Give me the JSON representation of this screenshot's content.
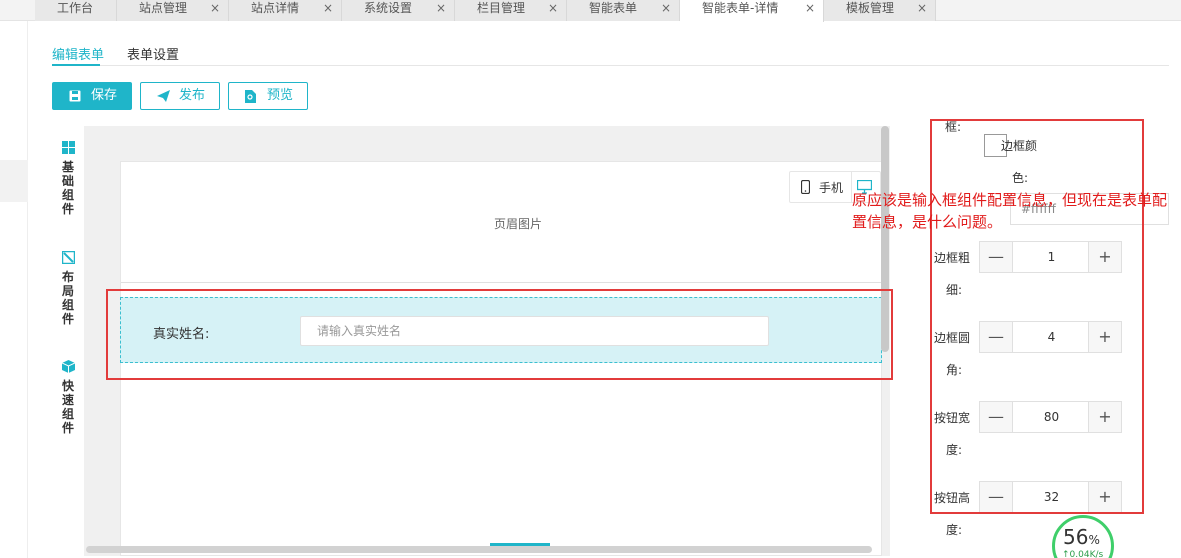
{
  "tabs": [
    {
      "label": "工作台",
      "closable": false
    },
    {
      "label": "站点管理",
      "closable": true
    },
    {
      "label": "站点详情",
      "closable": true
    },
    {
      "label": "系统设置",
      "closable": true
    },
    {
      "label": "栏目管理",
      "closable": true
    },
    {
      "label": "智能表单",
      "closable": true
    },
    {
      "label": "智能表单-详情",
      "closable": true,
      "active": true
    },
    {
      "label": "模板管理",
      "closable": true
    }
  ],
  "tab_close_glyph": "×",
  "subtabs": {
    "edit": "编辑表单",
    "settings": "表单设置"
  },
  "toolbar": {
    "save": "保存",
    "publish": "发布",
    "preview": "预览"
  },
  "palette": {
    "basic": [
      "基",
      "础",
      "组",
      "件"
    ],
    "layout": [
      "布",
      "局",
      "组",
      "件"
    ],
    "quick": [
      "快",
      "速",
      "组",
      "件"
    ]
  },
  "canvas": {
    "device_mobile": "手机",
    "header_image": "页眉图片",
    "field_label": "真实姓名:",
    "field_placeholder": "请输入真实姓名"
  },
  "panel": {
    "cut_label": "框:",
    "border_color_label_a": "边框颜",
    "border_color_label_b": "色:",
    "border_color_value": "#ffffff",
    "border_width_label_a": "边框粗",
    "border_width_label_b": "细:",
    "border_width_value": "1",
    "border_radius_label_a": "边框圆",
    "border_radius_label_b": "角:",
    "border_radius_value": "4",
    "button_width_label_a": "按钮宽",
    "button_width_label_b": "度:",
    "button_width_value": "80",
    "button_height_label_a": "按钮高",
    "button_height_label_b": "度:",
    "button_height_value": "32",
    "minus": "—",
    "plus": "+"
  },
  "annotation": "原应该是输入框组件配置信息，但现在是表单配置信息，是什么问题。",
  "meter": {
    "value": "56",
    "unit": "%",
    "sub": "↑0.04K/s"
  },
  "colors": {
    "accent": "#1fb5c9",
    "annotation_red": "#e23b3b",
    "meter_green": "#3fcf6a"
  }
}
